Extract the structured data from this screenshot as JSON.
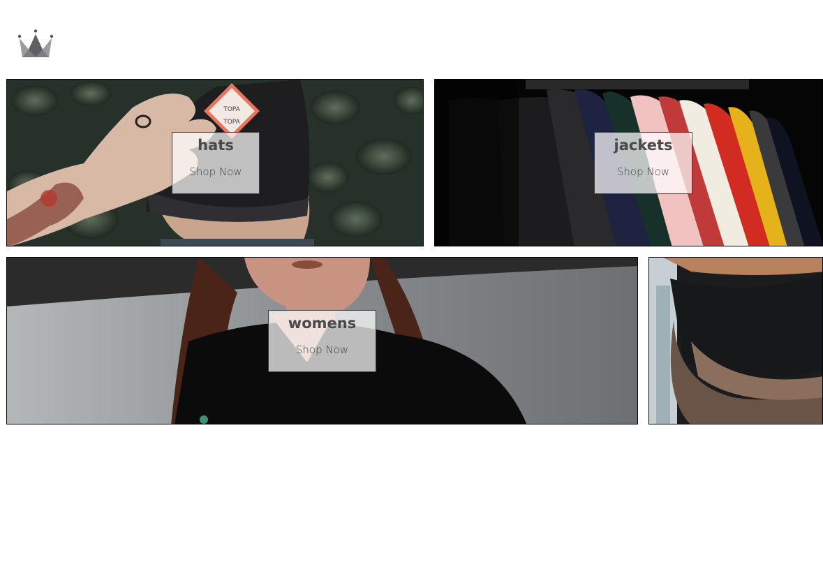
{
  "brand": {
    "logo_icon": "crown-icon",
    "logo_color": "#6f7274"
  },
  "categories": [
    {
      "title": "hats",
      "cta": "Shop Now"
    },
    {
      "title": "jackets",
      "cta": "Shop Now"
    },
    {
      "title": "womens",
      "cta": "Shop Now"
    },
    {
      "title": "",
      "cta": ""
    }
  ]
}
